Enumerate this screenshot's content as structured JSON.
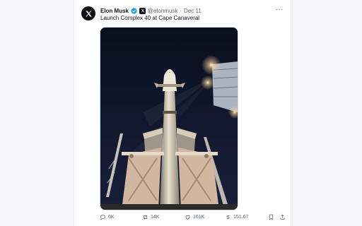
{
  "tweet": {
    "author_name": "Elon Musk",
    "handle": "@elonmusk",
    "separator": "·",
    "date": "Dec 11",
    "text": "Launch Complex 40 at Cape Canaveral",
    "more_label": "···"
  },
  "actions": {
    "replies": "6K",
    "reposts": "14K",
    "likes": "161K",
    "views": "151.67"
  },
  "colors": {
    "verified": "#1d9bf0",
    "text": "#0f1419",
    "muted": "#536471"
  },
  "icons": [
    "x-logo-icon",
    "verified-badge-icon",
    "affiliate-x-icon",
    "more-icon",
    "reply-icon",
    "repost-icon",
    "like-icon",
    "views-icon",
    "bookmark-icon",
    "share-icon"
  ]
}
